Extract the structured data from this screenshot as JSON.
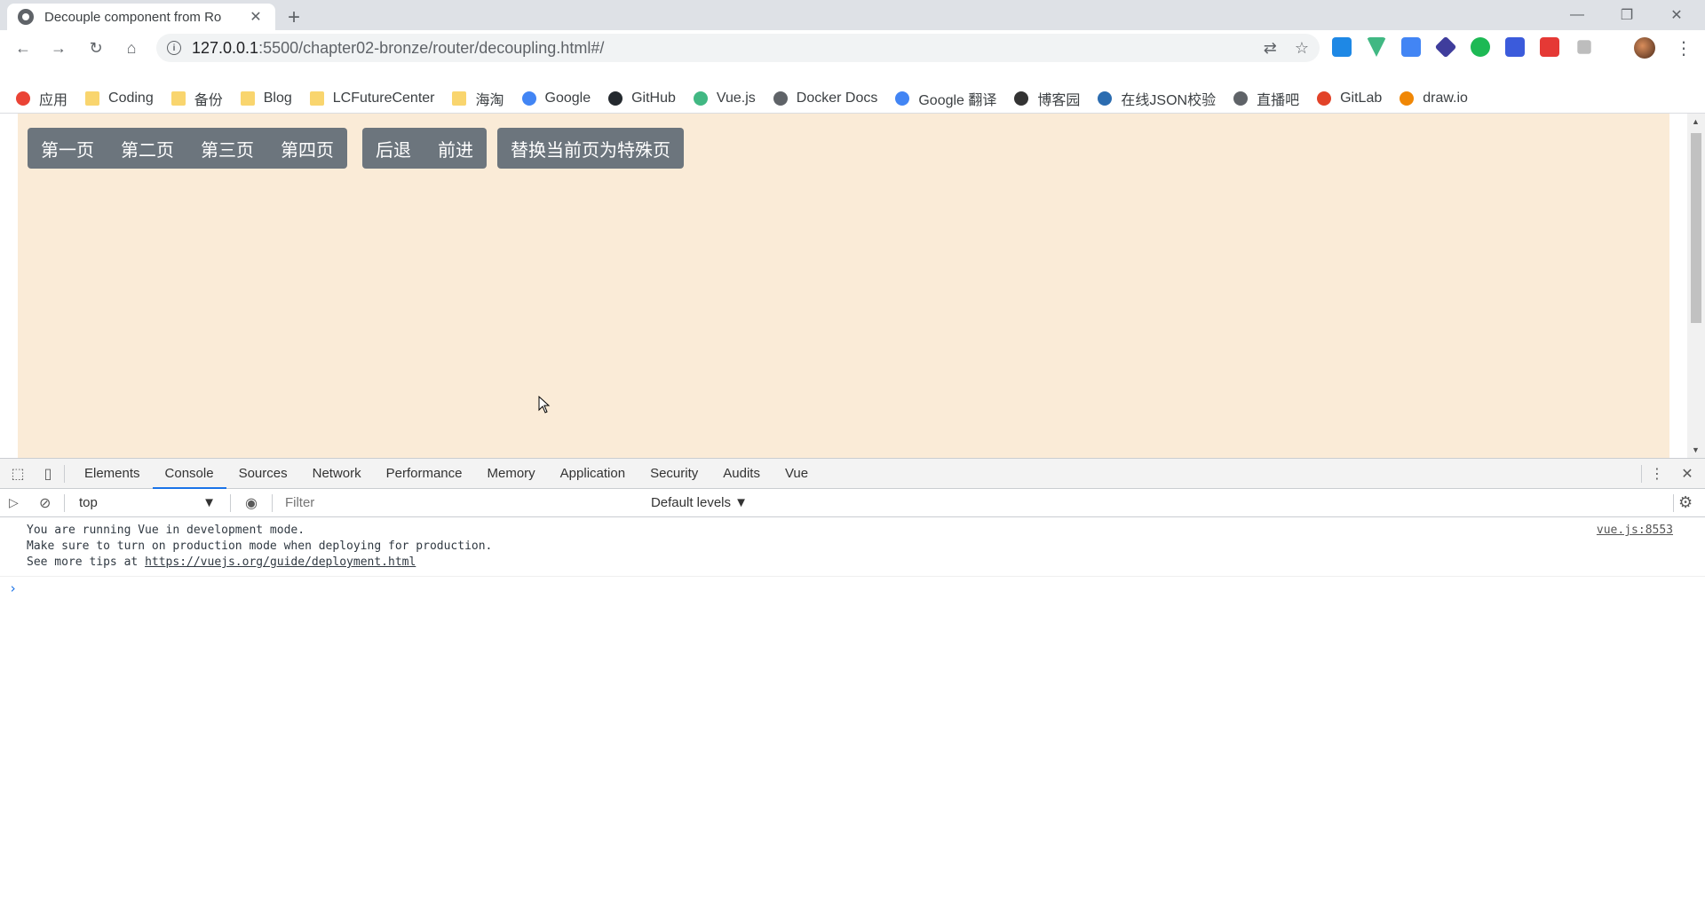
{
  "browser": {
    "tab_title": "Decouple component from Ro",
    "new_tab": "+",
    "tab_close": "✕",
    "url_host": "127.0.0.1",
    "url_path": ":5500/chapter02-bronze/router/decoupling.html#/",
    "window_controls": [
      "—",
      "❐",
      "✕"
    ]
  },
  "bookmarks": [
    {
      "label": "应用",
      "icon": "apps-grid-icon",
      "color": "#ea4335"
    },
    {
      "label": "Coding",
      "icon": "folder-icon",
      "color": "#f9d56e"
    },
    {
      "label": "备份",
      "icon": "folder-icon",
      "color": "#f9d56e"
    },
    {
      "label": "Blog",
      "icon": "folder-icon",
      "color": "#f9d56e"
    },
    {
      "label": "LCFutureCenter",
      "icon": "folder-icon",
      "color": "#f9d56e"
    },
    {
      "label": "海淘",
      "icon": "folder-icon",
      "color": "#f9d56e"
    },
    {
      "label": "Google",
      "icon": "google-icon",
      "color": "#4285f4"
    },
    {
      "label": "GitHub",
      "icon": "github-icon",
      "color": "#24292e"
    },
    {
      "label": "Vue.js",
      "icon": "vue-icon",
      "color": "#41b883"
    },
    {
      "label": "Docker Docs",
      "icon": "globe-icon",
      "color": "#5f6368"
    },
    {
      "label": "Google 翻译",
      "icon": "translate-icon",
      "color": "#4285f4"
    },
    {
      "label": "博客园",
      "icon": "cnblogs-icon",
      "color": "#333333"
    },
    {
      "label": "在线JSON校验",
      "icon": "code-icon",
      "color": "#2b6cb0"
    },
    {
      "label": "直播吧",
      "icon": "globe-icon",
      "color": "#5f6368"
    },
    {
      "label": "GitLab",
      "icon": "gitlab-icon",
      "color": "#e24329"
    },
    {
      "label": "draw.io",
      "icon": "drawio-icon",
      "color": "#f08705"
    }
  ],
  "page": {
    "background": "#faebd7",
    "nav_group": [
      "第一页",
      "第二页",
      "第三页",
      "第四页"
    ],
    "history_group": [
      "后退",
      "前进"
    ],
    "replace_button": "替换当前页为特殊页"
  },
  "devtools": {
    "tabs": [
      "Elements",
      "Console",
      "Sources",
      "Network",
      "Performance",
      "Memory",
      "Application",
      "Security",
      "Audits",
      "Vue"
    ],
    "active_tab": "Console",
    "context": "top",
    "filter_placeholder": "Filter",
    "levels": "Default levels ▼",
    "messages": {
      "line1": "You are running Vue in development mode.",
      "line2": "Make sure to turn on production mode when deploying for production.",
      "line3_prefix": "See more tips at ",
      "line3_link": "https://vuejs.org/guide/deployment.html",
      "source": "vue.js:8553"
    },
    "prompt": "›"
  }
}
